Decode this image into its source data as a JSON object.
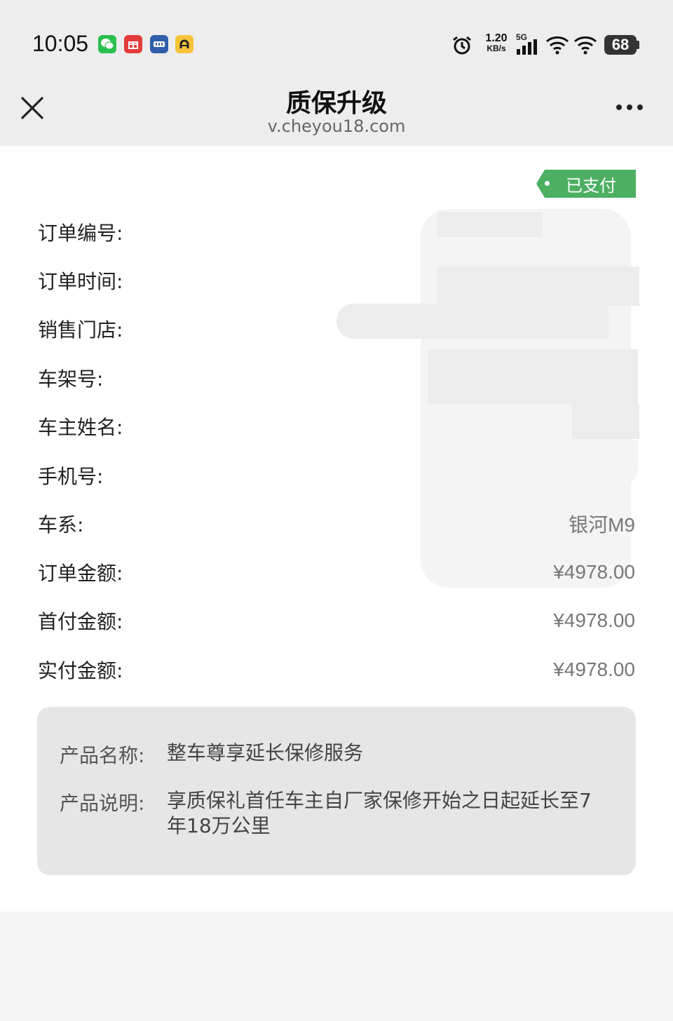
{
  "status_bar": {
    "time": "10:05",
    "net_speed_value": "1.20",
    "net_speed_unit": "KB/s",
    "signal_type": "5G",
    "battery": "68",
    "icons": [
      "wechat-icon",
      "gift-app-icon",
      "card-app-icon",
      "car-app-icon",
      "alarm-icon",
      "signal-icon",
      "wifi-icon",
      "wifi-icon"
    ]
  },
  "nav": {
    "title": "质保升级",
    "url": "v.cheyou18.com",
    "close_icon": "close-icon",
    "more_icon": "more-icon"
  },
  "order": {
    "status_badge": "已支付",
    "fields": [
      {
        "label": "订单编号:",
        "value": ""
      },
      {
        "label": "订单时间:",
        "value": ""
      },
      {
        "label": "销售门店:",
        "value": ""
      },
      {
        "label": "车架号:",
        "value": ""
      },
      {
        "label": "车主姓名:",
        "value": ""
      },
      {
        "label": "手机号:",
        "value": ""
      },
      {
        "label": "车系:",
        "value": "银河M9"
      },
      {
        "label": "订单金额:",
        "value": "¥4978.00"
      },
      {
        "label": "首付金额:",
        "value": "¥4978.00"
      },
      {
        "label": "实付金额:",
        "value": "¥4978.00"
      }
    ]
  },
  "product": {
    "name_label": "产品名称:",
    "name_value": "整车尊享延长保修服务",
    "desc_label": "产品说明:",
    "desc_value": "享质保礼首任车主自厂家保修开始之日起延长至7年18万公里"
  },
  "colors": {
    "badge_green": "#4caf62",
    "bar_gray": "#ededed",
    "product_box": "#e6e6e6"
  }
}
